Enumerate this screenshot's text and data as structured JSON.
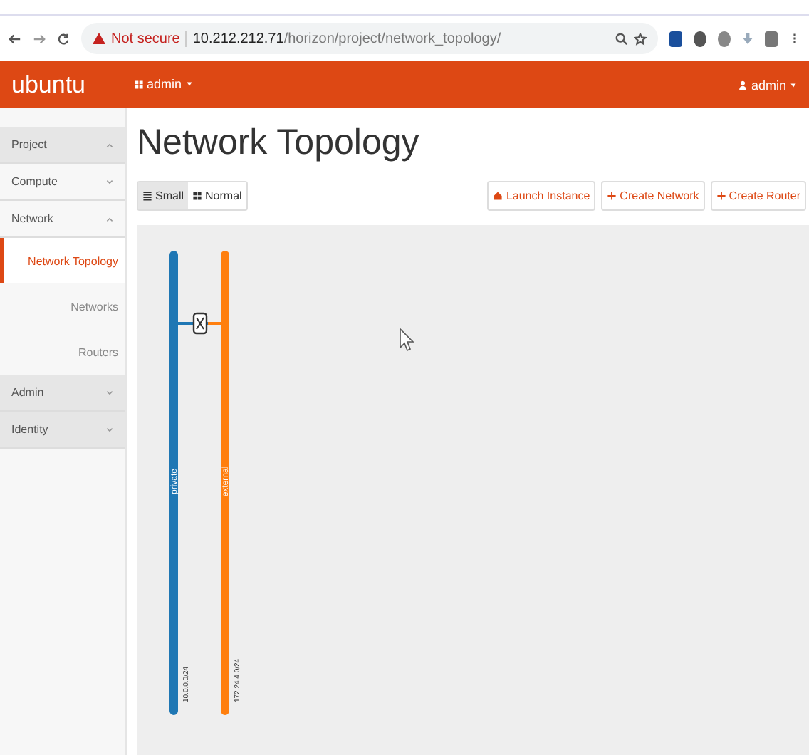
{
  "browser": {
    "security": "Not secure",
    "url_host": "10.212.212.71",
    "url_path": "/horizon/project/network_topology/"
  },
  "header": {
    "logo": "ubuntu",
    "project_menu": "admin",
    "user_menu": "admin"
  },
  "sidebar": {
    "items": [
      {
        "label": "Project",
        "expanded": true,
        "children": [
          {
            "label": "Compute",
            "expanded": false
          },
          {
            "label": "Network",
            "expanded": true,
            "children": [
              {
                "label": "Network Topology",
                "selected": true
              },
              {
                "label": "Networks",
                "selected": false
              },
              {
                "label": "Routers",
                "selected": false
              }
            ]
          }
        ]
      },
      {
        "label": "Admin",
        "expanded": false
      },
      {
        "label": "Identity",
        "expanded": false
      }
    ]
  },
  "page": {
    "title": "Network Topology"
  },
  "view_toggle": [
    {
      "label": "Small",
      "selected": true
    },
    {
      "label": "Normal",
      "selected": false
    }
  ],
  "actions": [
    {
      "label": "Launch Instance",
      "kind": "launch"
    },
    {
      "label": "Create Network",
      "kind": "create"
    },
    {
      "label": "Create Router",
      "kind": "create"
    }
  ],
  "topology": {
    "networks": [
      {
        "name": "private",
        "cidr": "10.0.0.0/24",
        "color": "#1f77b4"
      },
      {
        "name": "external",
        "cidr": "172.24.4.0/24",
        "color": "#ff7f0e"
      }
    ]
  }
}
